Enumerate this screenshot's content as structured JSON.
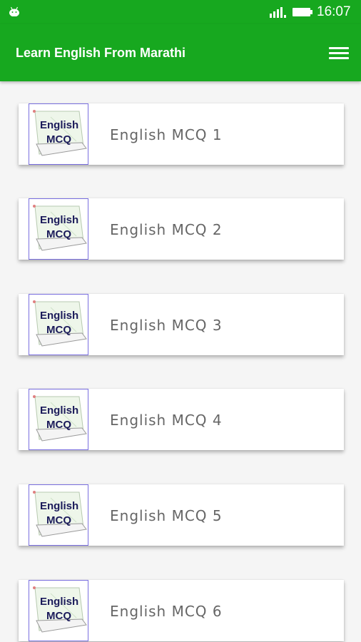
{
  "status_bar": {
    "time": "16:07",
    "icons": [
      "android-icon",
      "signal-icon",
      "battery-icon"
    ]
  },
  "app_bar": {
    "title": "Learn English From Marathi",
    "menu_icon": "hamburger-menu-icon"
  },
  "items": [
    {
      "label": "English MCQ 1",
      "thumb_text": [
        "English",
        "MCQ"
      ]
    },
    {
      "label": "English MCQ 2",
      "thumb_text": [
        "English",
        "MCQ"
      ]
    },
    {
      "label": "English MCQ 3",
      "thumb_text": [
        "English",
        "MCQ"
      ]
    },
    {
      "label": "English MCQ 4",
      "thumb_text": [
        "English",
        "MCQ"
      ]
    },
    {
      "label": "English MCQ 5",
      "thumb_text": [
        "English",
        "MCQ"
      ]
    },
    {
      "label": "English MCQ 6",
      "thumb_text": [
        "English",
        "MCQ"
      ]
    }
  ],
  "colors": {
    "primary": "#17a81f",
    "card_text": "#666666",
    "thumb_border": "#7a6fe0"
  }
}
